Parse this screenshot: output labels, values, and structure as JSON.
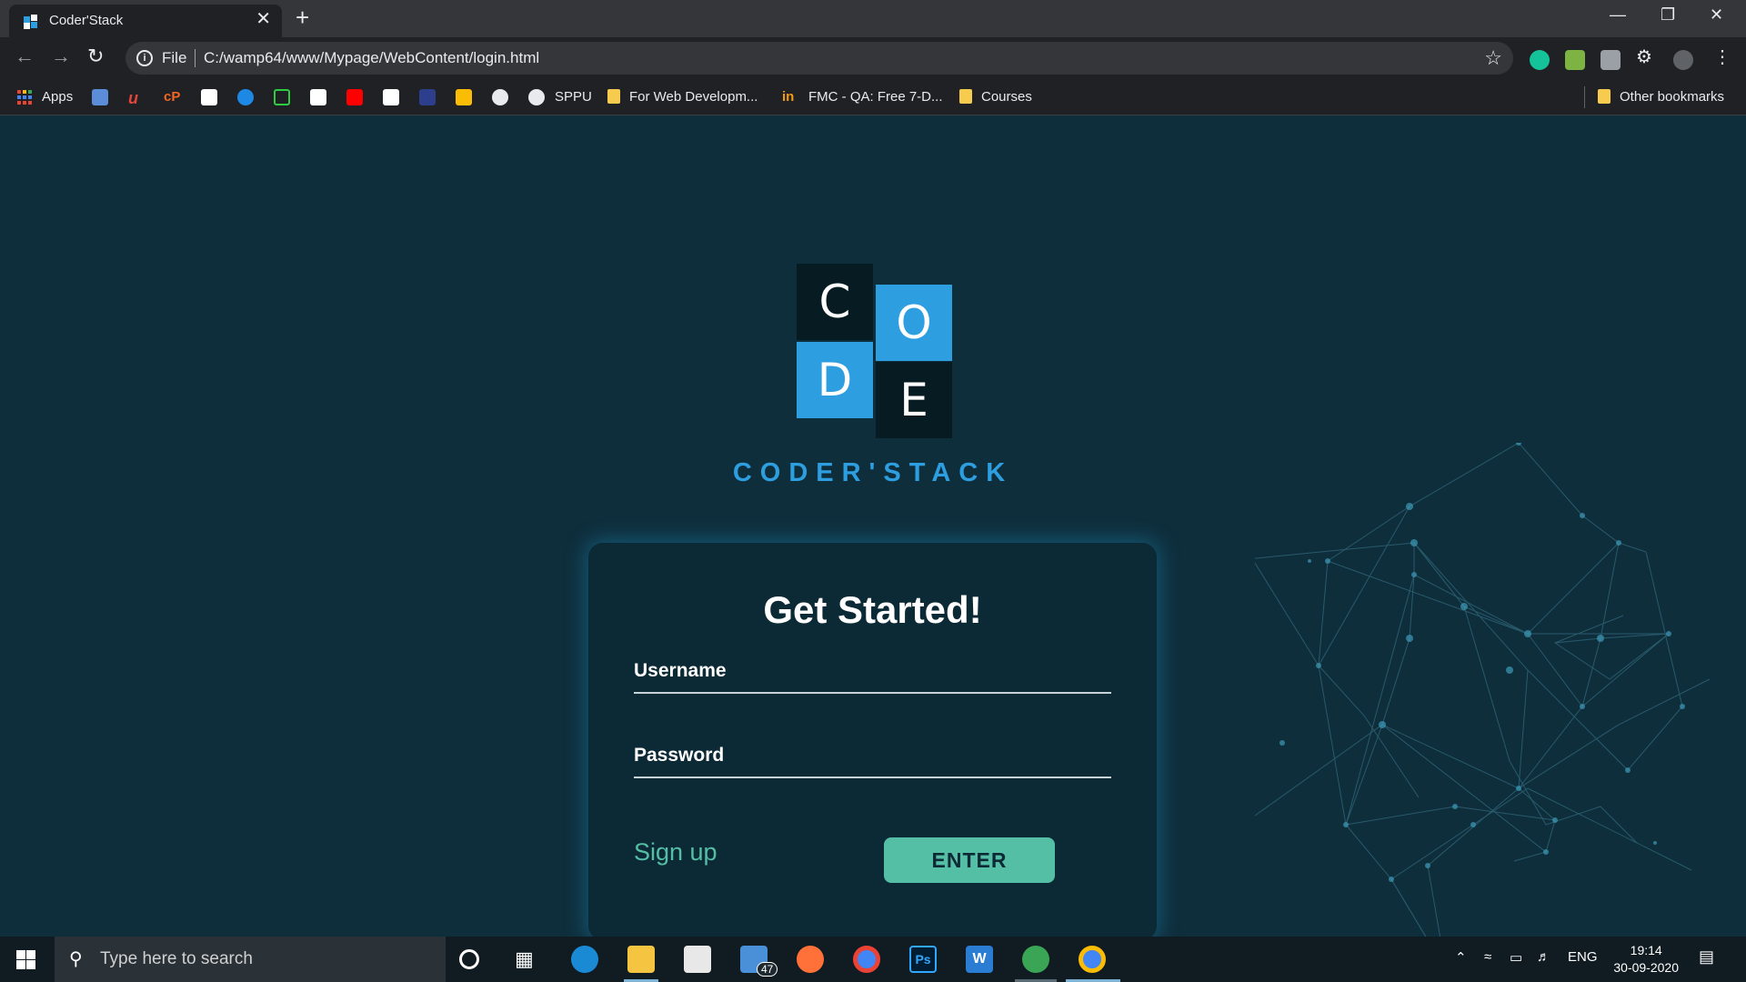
{
  "browser": {
    "tab_title": "Coder'Stack",
    "tab_close": "✕",
    "new_tab": "+",
    "url_scheme": "File",
    "url": "C:/wamp64/www/Mypage/WebContent/login.html",
    "bookmarks": [
      {
        "label": "Apps",
        "icon": "apps-grid-icon"
      },
      {
        "label": "SPPU",
        "icon": "globe-icon"
      },
      {
        "label": "For Web Developm...",
        "icon": "folder-icon"
      },
      {
        "label": "FMC - QA: Free 7-D...",
        "icon": "fmc-icon"
      },
      {
        "label": "Courses",
        "icon": "folder-icon"
      },
      {
        "label": "Other bookmarks",
        "icon": "folder-icon"
      }
    ]
  },
  "logo": {
    "letters": [
      "C",
      "O",
      "D",
      "E"
    ],
    "brand": "CODER'STACK"
  },
  "login": {
    "title": "Get Started!",
    "username_placeholder": "Username",
    "password_placeholder": "Password",
    "signup_label": "Sign up",
    "enter_label": "ENTER"
  },
  "taskbar": {
    "search_placeholder": "Type here to search",
    "mail_badge": "47",
    "language": "ENG",
    "time": "19:14",
    "date": "30-09-2020"
  },
  "colors": {
    "page_background": "#0f2e3c",
    "card_background": "#0c2a36",
    "accent_teal": "#55bfa6",
    "brand_blue": "#2d9ee0",
    "logo_dark_tile": "#061c22",
    "logo_blue_tile": "#2d9ee0"
  }
}
